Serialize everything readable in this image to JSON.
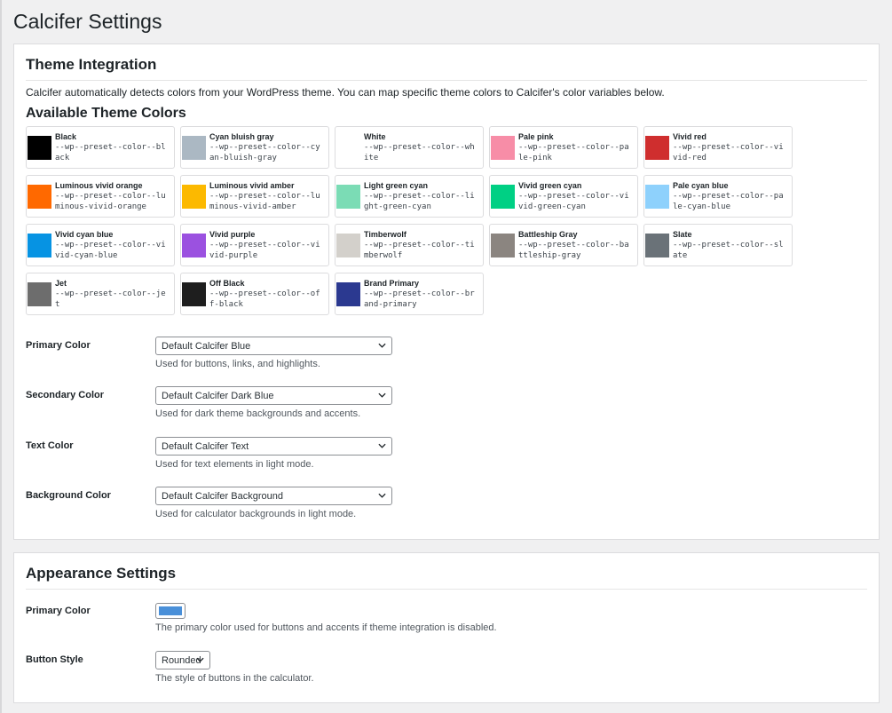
{
  "page": {
    "title": "Calcifer Settings"
  },
  "theme_integration": {
    "heading": "Theme Integration",
    "intro": "Calcifer automatically detects colors from your WordPress theme. You can map specific theme colors to Calcifer's color variables below.",
    "colors_heading": "Available Theme Colors",
    "swatches": [
      {
        "name": "Black",
        "var": "--wp--preset--color--black",
        "color": "#000000"
      },
      {
        "name": "Cyan bluish gray",
        "var": "--wp--preset--color--cyan-bluish-gray",
        "color": "#abb8c3"
      },
      {
        "name": "White",
        "var": "--wp--preset--color--white",
        "color": "#ffffff"
      },
      {
        "name": "Pale pink",
        "var": "--wp--preset--color--pale-pink",
        "color": "#f78da7"
      },
      {
        "name": "Vivid red",
        "var": "--wp--preset--color--vivid-red",
        "color": "#cf2e2e"
      },
      {
        "name": "Luminous vivid orange",
        "var": "--wp--preset--color--luminous-vivid-orange",
        "color": "#ff6900"
      },
      {
        "name": "Luminous vivid amber",
        "var": "--wp--preset--color--luminous-vivid-amber",
        "color": "#fcb900"
      },
      {
        "name": "Light green cyan",
        "var": "--wp--preset--color--light-green-cyan",
        "color": "#7bdcb5"
      },
      {
        "name": "Vivid green cyan",
        "var": "--wp--preset--color--vivid-green-cyan",
        "color": "#00d084"
      },
      {
        "name": "Pale cyan blue",
        "var": "--wp--preset--color--pale-cyan-blue",
        "color": "#8ed1fc"
      },
      {
        "name": "Vivid cyan blue",
        "var": "--wp--preset--color--vivid-cyan-blue",
        "color": "#0693e3"
      },
      {
        "name": "Vivid purple",
        "var": "--wp--preset--color--vivid-purple",
        "color": "#9b51e0"
      },
      {
        "name": "Timberwolf",
        "var": "--wp--preset--color--timberwolf",
        "color": "#d3d0cb"
      },
      {
        "name": "Battleship Gray",
        "var": "--wp--preset--color--battleship-gray",
        "color": "#8b8580"
      },
      {
        "name": "Slate",
        "var": "--wp--preset--color--slate",
        "color": "#6a7278"
      },
      {
        "name": "Jet",
        "var": "--wp--preset--color--jet",
        "color": "#6d6d6d"
      },
      {
        "name": "Off Black",
        "var": "--wp--preset--color--off-black",
        "color": "#1e1e1e"
      },
      {
        "name": "Brand Primary",
        "var": "--wp--preset--color--brand-primary",
        "color": "#2b3990"
      }
    ],
    "fields": [
      {
        "label": "Primary Color",
        "value": "Default Calcifer Blue",
        "desc": "Used for buttons, links, and highlights."
      },
      {
        "label": "Secondary Color",
        "value": "Default Calcifer Dark Blue",
        "desc": "Used for dark theme backgrounds and accents."
      },
      {
        "label": "Text Color",
        "value": "Default Calcifer Text",
        "desc": "Used for text elements in light mode."
      },
      {
        "label": "Background Color",
        "value": "Default Calcifer Background",
        "desc": "Used for calculator backgrounds in light mode."
      }
    ]
  },
  "appearance": {
    "heading": "Appearance Settings",
    "primary_color": {
      "label": "Primary Color",
      "value_color": "#4a90d9",
      "desc": "The primary color used for buttons and accents if theme integration is disabled."
    },
    "button_style": {
      "label": "Button Style",
      "value": "Rounded",
      "desc": "The style of buttons in the calculator."
    }
  },
  "icons": {
    "select_arrow": "chevron-down-icon"
  }
}
